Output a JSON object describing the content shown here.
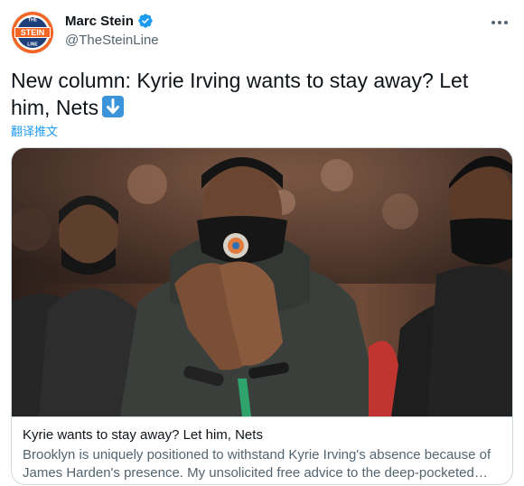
{
  "author": {
    "display_name": "Marc Stein",
    "handle": "@TheSteinLine",
    "avatar_text": "STEIN",
    "avatar_prefix": "THE",
    "avatar_suffix": "LINE"
  },
  "tweet": {
    "text": "New column: Kyrie Irving wants to stay away? Let him, Nets",
    "emoji_icon": "down-arrow-emoji",
    "translate_label": "翻译推文"
  },
  "card": {
    "title": "Kyrie wants to stay away? Let him, Nets",
    "description": "Brooklyn is uniquely positioned to withstand Kyrie Irving's absence because of James Harden's presence. My unsolicited free advice to the deep-pocketed Joe..."
  },
  "colors": {
    "accent": "#1d9bf0",
    "verified": "#1d9bf0",
    "avatar_ring": "#f26522",
    "avatar_inner": "#1c3f7a"
  }
}
